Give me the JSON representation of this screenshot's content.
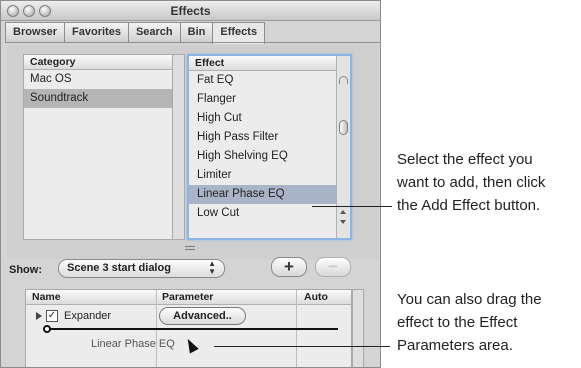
{
  "window": {
    "title": "Effects",
    "tabs": [
      {
        "label": "Browser",
        "active": false
      },
      {
        "label": "Favorites",
        "active": false
      },
      {
        "label": "Search",
        "active": false
      },
      {
        "label": "Bin",
        "active": false
      },
      {
        "label": "Effects",
        "active": true
      }
    ]
  },
  "category_list": {
    "header": "Category",
    "items": [
      {
        "label": "Mac OS",
        "selected": false
      },
      {
        "label": "Soundtrack",
        "selected": true
      }
    ]
  },
  "effect_list": {
    "header": "Effect",
    "items": [
      {
        "label": "Fat EQ",
        "selected": false
      },
      {
        "label": "Flanger",
        "selected": false
      },
      {
        "label": "High Cut",
        "selected": false
      },
      {
        "label": "High Pass Filter",
        "selected": false
      },
      {
        "label": "High Shelving EQ",
        "selected": false
      },
      {
        "label": "Limiter",
        "selected": false
      },
      {
        "label": "Linear Phase EQ",
        "selected": true
      },
      {
        "label": "Low Cut",
        "selected": false
      }
    ]
  },
  "show_row": {
    "label": "Show:",
    "selected_value": "Scene 3 start dialog",
    "add_label": "+",
    "remove_label": "−"
  },
  "param_table": {
    "columns": [
      "Name",
      "Parameter",
      "Auto"
    ],
    "rows": [
      {
        "name": "Expander",
        "checked": true,
        "parameter_button": "Advanced.."
      }
    ],
    "dragging_item": "Linear Phase EQ"
  },
  "callouts": {
    "top": [
      "Select the effect you",
      "want to add, then click",
      "the Add Effect button."
    ],
    "bottom": [
      "You can also drag the",
      "effect to the Effect",
      "Parameters area."
    ]
  },
  "colors": {
    "selection_effect": "#a9b4c8",
    "selection_category": "#b5b5b5",
    "focus_ring": "#8db4e6"
  }
}
